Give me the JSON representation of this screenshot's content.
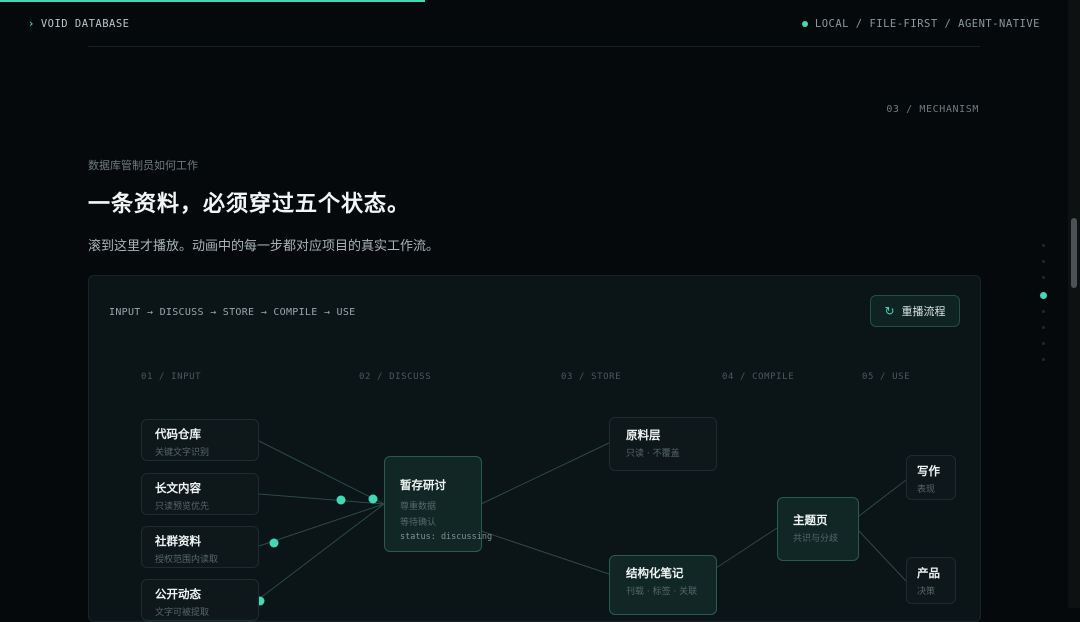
{
  "header": {
    "brand": "VOID DATABASE",
    "mode": "LOCAL / FILE-FIRST / AGENT-NATIVE"
  },
  "section": {
    "number": "03 / MECHANISM",
    "eyebrow": "数据库管制员如何工作",
    "title": "一条资料，必须穿过五个状态。",
    "subtitle": "滚到这里才播放。动画中的每一步都对应项目的真实工作流。"
  },
  "flow": {
    "pipeline": "INPUT → DISCUSS → STORE → COMPILE → USE",
    "replay_label": "重播流程",
    "replay_icon": "refresh-icon",
    "stages": [
      "01 / INPUT",
      "02 / DISCUSS",
      "03 / STORE",
      "04 / COMPILE",
      "05 / USE"
    ],
    "inputs": [
      {
        "title": "代码仓库",
        "sub": "关键文字识别"
      },
      {
        "title": "长文内容",
        "sub": "只读预览优先"
      },
      {
        "title": "社群资料",
        "sub": "授权范围内读取"
      },
      {
        "title": "公开动态",
        "sub": "文字可被提取"
      }
    ],
    "discuss": {
      "title": "暂存研讨",
      "line1": "尊重数据",
      "line2": "等待确认",
      "status": "status: discussing"
    },
    "store": [
      {
        "title": "原料层",
        "sub": "只读 · 不覆盖"
      },
      {
        "title": "结构化笔记",
        "sub": "刊载 · 标签 · 关联"
      }
    ],
    "compile": {
      "title": "主题页",
      "sub": "共识与分歧"
    },
    "use": [
      {
        "title": "写作",
        "sub": "表现"
      },
      {
        "title": "产品",
        "sub": "决策"
      }
    ]
  },
  "colors": {
    "accent": "#3fd9b6",
    "background": "#05090b",
    "panel": "#0b1416"
  }
}
